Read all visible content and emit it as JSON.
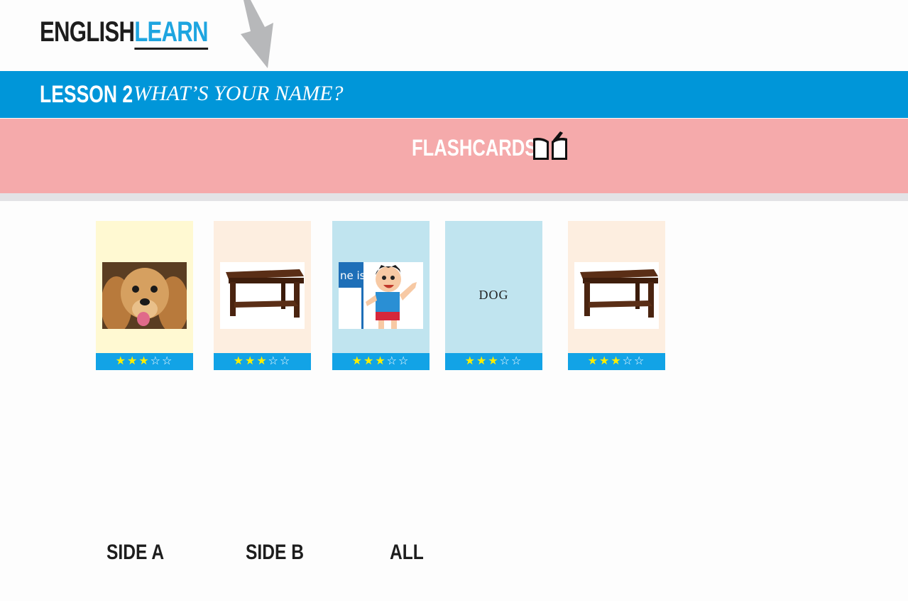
{
  "logo": {
    "english": "ENGLISH",
    "learn": "LEARN"
  },
  "lesson": {
    "number": "LESSON 2",
    "title": "WHAT’S YOUR NAME?"
  },
  "banner": {
    "title": "FLASHCARDS",
    "icon": "book-icon"
  },
  "cards": [
    {
      "background": "#fff9d2",
      "image": "dog-photo",
      "word": "",
      "rating": 3,
      "max_rating": 5
    },
    {
      "background": "#fdeee0",
      "image": "table-photo",
      "word": "",
      "rating": 3,
      "max_rating": 5
    },
    {
      "background": "#c0e4ef",
      "image": "boy-waving-illustration",
      "word": "",
      "image_text": "ne is",
      "rating": 3,
      "max_rating": 5
    },
    {
      "background": "#c0e4ef",
      "image": "",
      "word": "DOG",
      "rating": 3,
      "max_rating": 5
    },
    {
      "background": "#fdeee0",
      "image": "table-photo",
      "word": "",
      "rating": 3,
      "max_rating": 5
    }
  ],
  "buttons": {
    "side_a": "SIDE A",
    "side_b": "SIDE B",
    "all": "ALL"
  },
  "colors": {
    "lesson_bar": "#0096d9",
    "banner": "#f5aaab",
    "rating_bar": "#12a3e6",
    "accent": "#1ea5e0"
  }
}
